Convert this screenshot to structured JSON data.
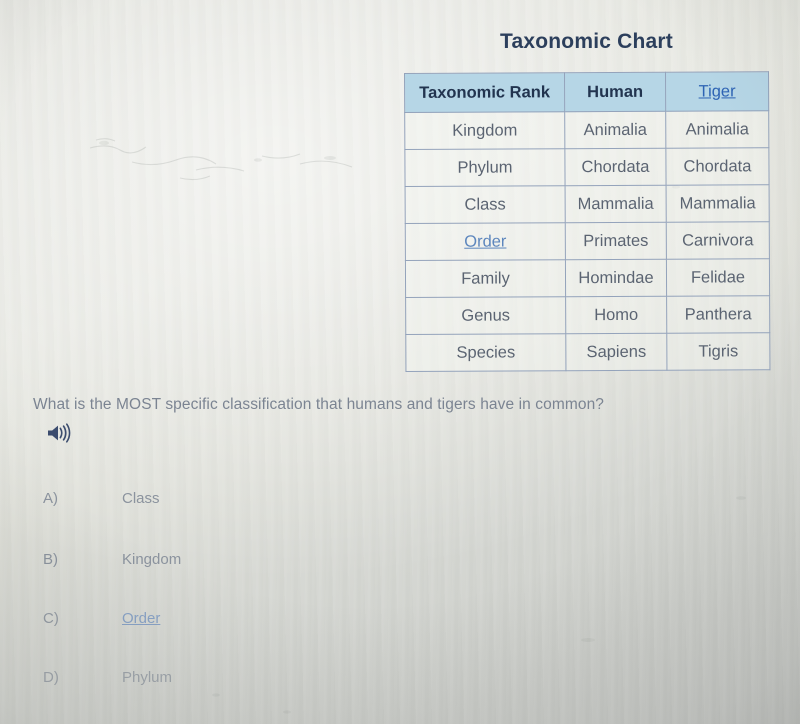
{
  "chart": {
    "title": "Taxonomic Chart",
    "columns": [
      "Taxonomic Rank",
      "Human",
      "Tiger"
    ],
    "rows": [
      {
        "rank": "Kingdom",
        "human": "Animalia",
        "tiger": "Animalia"
      },
      {
        "rank": "Phylum",
        "human": "Chordata",
        "tiger": "Chordata"
      },
      {
        "rank": "Class",
        "human": "Mammalia",
        "tiger": "Mammalia"
      },
      {
        "rank": "Order",
        "human": "Primates",
        "tiger": "Carnivora"
      },
      {
        "rank": "Family",
        "human": "Homindae",
        "tiger": "Felidae"
      },
      {
        "rank": "Genus",
        "human": "Homo",
        "tiger": "Panthera"
      },
      {
        "rank": "Species",
        "human": "Sapiens",
        "tiger": "Tigris"
      }
    ]
  },
  "question": {
    "text": "What is the MOST specific classification that humans and tigers have in common?",
    "audio_icon": "speaker-icon"
  },
  "choices": [
    {
      "letter": "A)",
      "text": "Class"
    },
    {
      "letter": "B)",
      "text": "Kingdom"
    },
    {
      "letter": "C)",
      "text": "Order"
    },
    {
      "letter": "D)",
      "text": "Phylum"
    }
  ],
  "colors": {
    "header_fill": "#b6d6e6",
    "header_text": "#22344f",
    "link": "#2d63b4",
    "body_text": "#5b6472",
    "question_text": "#7b8492",
    "background": "#dcddd6"
  }
}
